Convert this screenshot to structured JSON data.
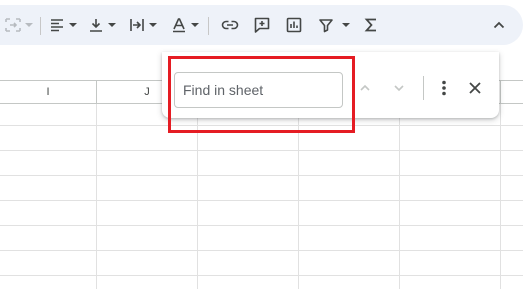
{
  "toolbar": {
    "items": [
      {
        "name": "merge-cells-icon",
        "enabled": false,
        "has_dropdown": true
      },
      {
        "name": "horizontal-align-icon",
        "enabled": true,
        "has_dropdown": true
      },
      {
        "name": "vertical-align-icon",
        "enabled": true,
        "has_dropdown": true
      },
      {
        "name": "text-wrapping-icon",
        "enabled": true,
        "has_dropdown": true
      },
      {
        "name": "text-rotation-icon",
        "enabled": true,
        "has_dropdown": true
      },
      {
        "name": "insert-link-icon",
        "enabled": true
      },
      {
        "name": "insert-comment-icon",
        "enabled": true
      },
      {
        "name": "insert-chart-icon",
        "enabled": true
      },
      {
        "name": "filter-icon",
        "enabled": true,
        "has_dropdown": true
      },
      {
        "name": "functions-sigma-icon",
        "enabled": true
      },
      {
        "name": "collapse-toolbar-chevron-up-icon",
        "enabled": true
      }
    ]
  },
  "sheet": {
    "columns": [
      "I",
      "J",
      "",
      "",
      "",
      ""
    ]
  },
  "find_panel": {
    "placeholder": "Find in sheet",
    "value": "",
    "buttons": [
      "previous-match-chevron-up-icon",
      "next-match-chevron-down-icon",
      "more-options-vertical-dots-icon",
      "close-icon"
    ]
  },
  "colors": {
    "toolbar_bg": "#eef2f9",
    "highlight_border": "#e51c23",
    "grid_line": "#e1e1e1",
    "icon": "#444746"
  }
}
